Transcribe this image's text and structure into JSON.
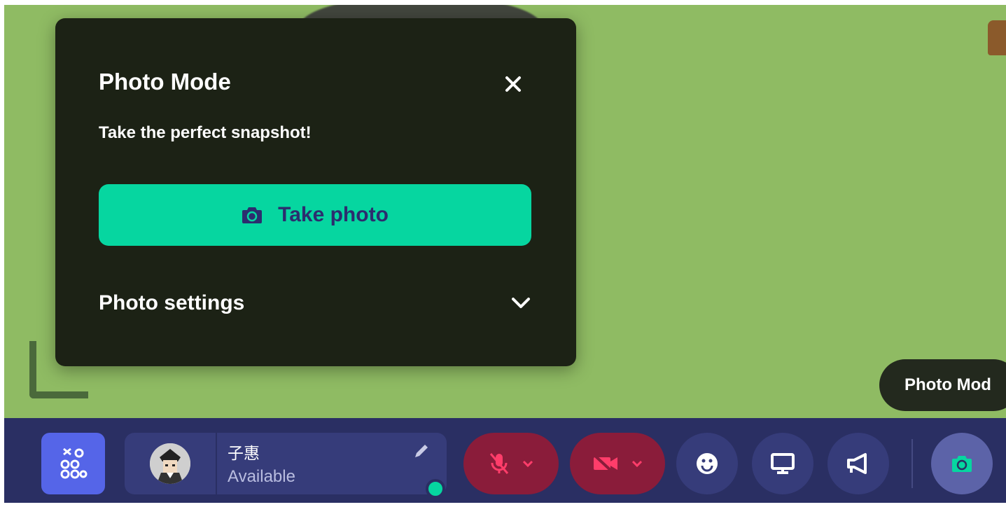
{
  "photo_panel": {
    "title": "Photo Mode",
    "subtitle": "Take the perfect snapshot!",
    "take_photo_label": "Take photo",
    "settings_label": "Photo settings"
  },
  "tooltip": {
    "text": "Photo Mod"
  },
  "toolbar": {
    "user": {
      "name": "子惠",
      "status": "Available"
    }
  },
  "colors": {
    "accent": "#06d6a0",
    "toolbar_bg": "#2a2f63",
    "panel_bg": "#1c2215",
    "muted_red": "#8a1c3a",
    "world_green": "#8fbb63"
  },
  "icons": {
    "close": "close-icon",
    "camera": "camera-icon",
    "chevron": "chevron-down-icon",
    "apps": "apps-icon",
    "edit": "pencil-icon",
    "mic": "mic-off-icon",
    "video": "video-off-icon",
    "emoji": "smiley-icon",
    "screen": "monitor-icon",
    "megaphone": "megaphone-icon"
  }
}
